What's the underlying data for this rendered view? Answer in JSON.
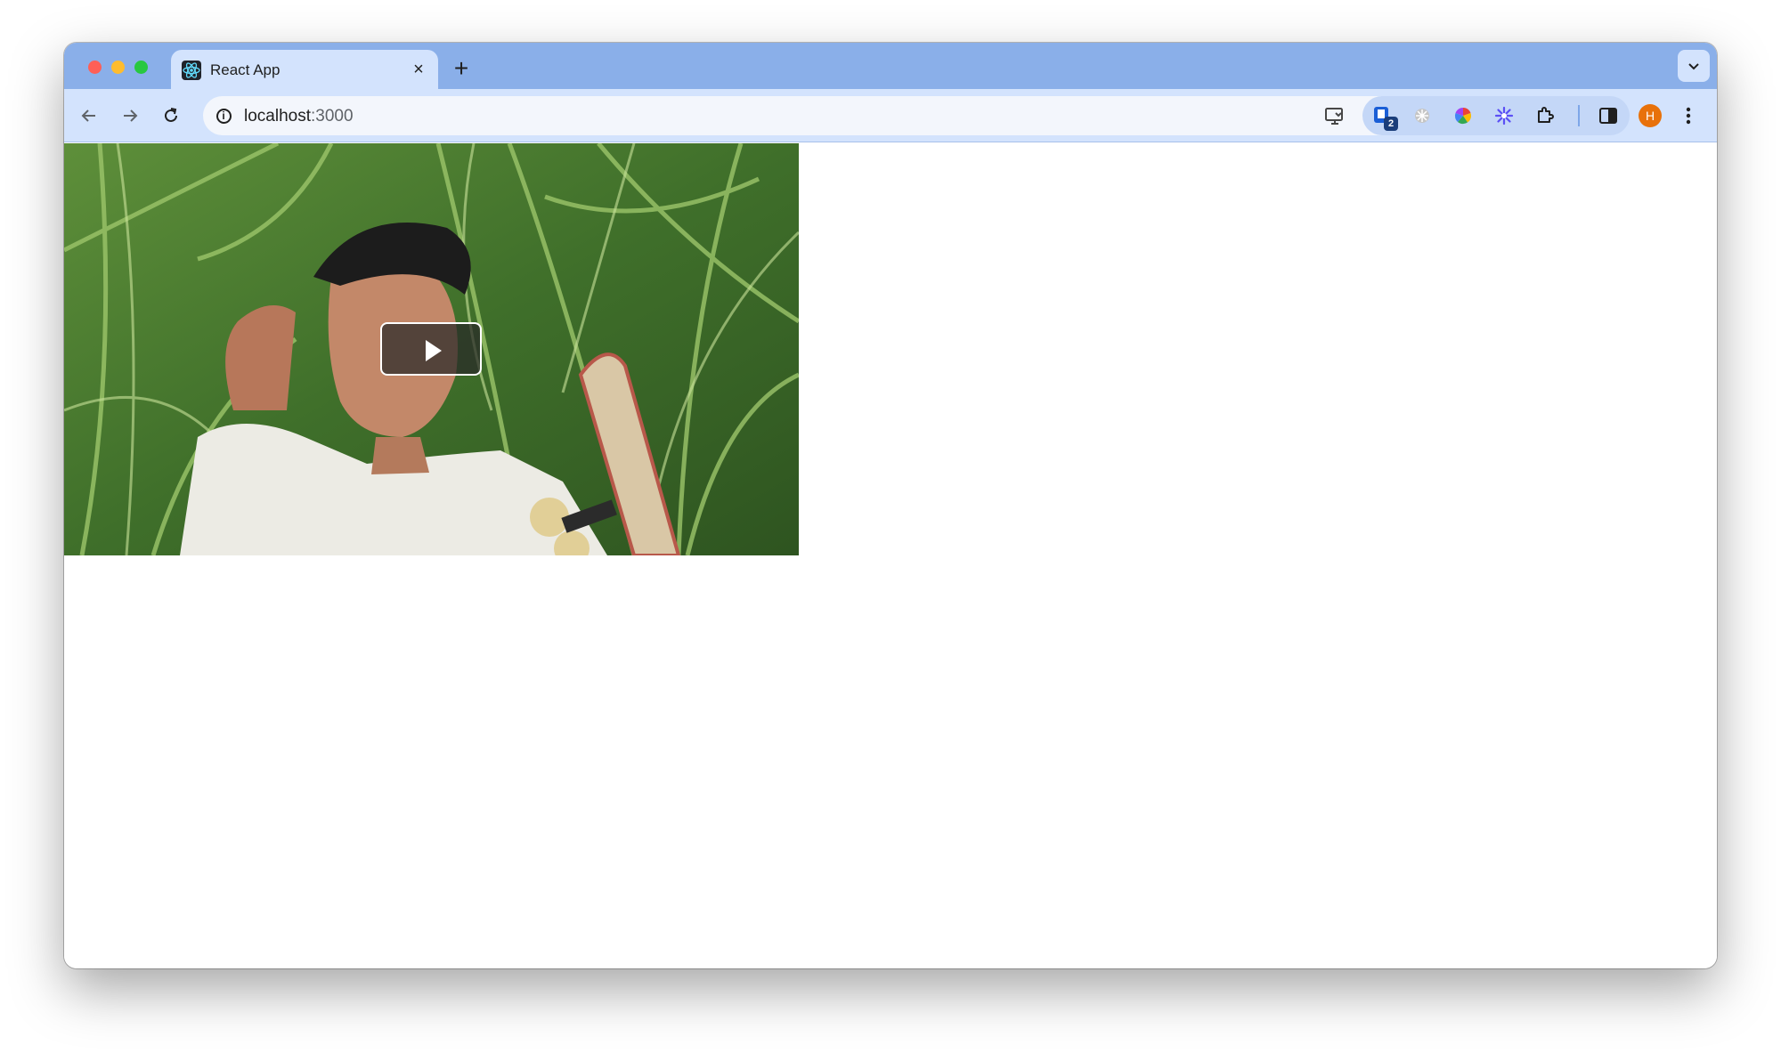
{
  "browser": {
    "tab": {
      "title": "React App",
      "favicon": "react-atom-icon",
      "close": "×"
    },
    "new_tab": "+",
    "tab_search_icon": "chevron-down-icon",
    "address": {
      "host": "localhost",
      "port": ":3000"
    },
    "extensions": {
      "badge_count": "2"
    },
    "profile_initial": "H"
  },
  "page": {
    "video": {
      "state": "paused",
      "control_icon": "play-icon"
    }
  }
}
